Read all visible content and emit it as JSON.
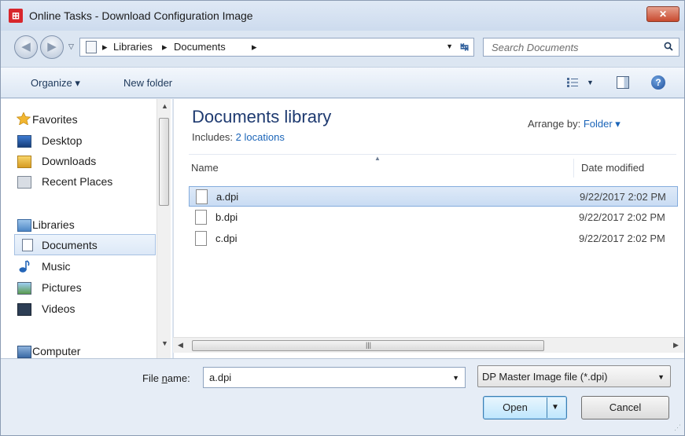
{
  "window": {
    "title": "Online Tasks - Download Configuration Image",
    "app_icon": "app-logo-icon",
    "close_label": "✕"
  },
  "address": {
    "crumbs": [
      "Libraries",
      "Documents"
    ],
    "search_placeholder": "Search Documents"
  },
  "toolbar": {
    "organize_label": "Organize ▾",
    "new_folder_label": "New folder"
  },
  "nav": {
    "favorites_label": "Favorites",
    "favorites": [
      "Desktop",
      "Downloads",
      "Recent Places"
    ],
    "libraries_label": "Libraries",
    "libraries": [
      "Documents",
      "Music",
      "Pictures",
      "Videos"
    ],
    "computer_label": "Computer",
    "selected": "Documents"
  },
  "content": {
    "library_title": "Documents library",
    "includes_label": "Includes:",
    "includes_link": "2 locations",
    "arrange_label": "Arrange by:",
    "arrange_value": "Folder ▾",
    "columns": {
      "name": "Name",
      "date": "Date modified"
    },
    "files": [
      {
        "name": "a.dpi",
        "date": "9/22/2017 2:02 PM",
        "selected": true
      },
      {
        "name": "b.dpi",
        "date": "9/22/2017 2:02 PM",
        "selected": false
      },
      {
        "name": "c.dpi",
        "date": "9/22/2017 2:02 PM",
        "selected": false
      }
    ]
  },
  "footer": {
    "file_name_label_pre": "File ",
    "file_name_label_key": "n",
    "file_name_label_post": "ame:",
    "file_name_value": "a.dpi",
    "file_type_value": "DP Master Image file (*.dpi)",
    "open_label": "Open",
    "cancel_label": "Cancel"
  },
  "colors": {
    "accent": "#1a64b8",
    "title_blue": "#1e3a70",
    "selection": "#c9dcf3"
  }
}
